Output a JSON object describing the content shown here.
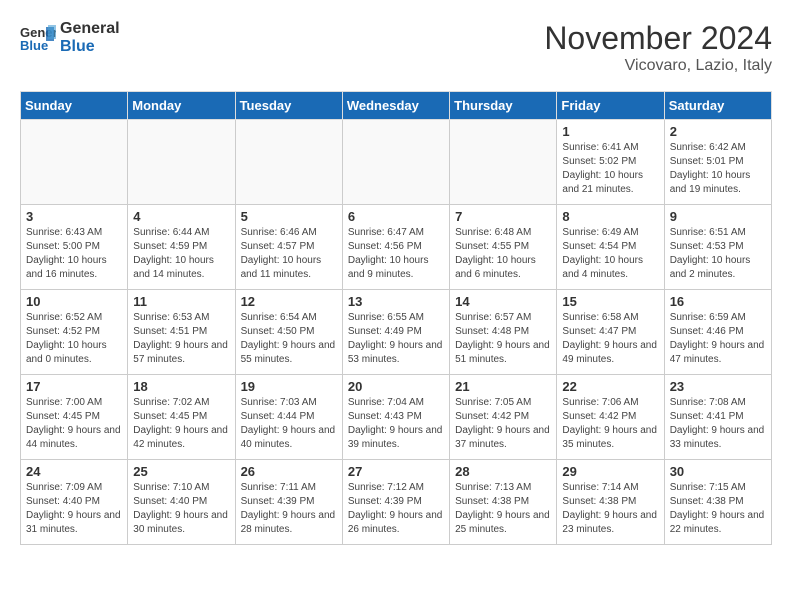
{
  "logo": {
    "line1": "General",
    "line2": "Blue"
  },
  "title": "November 2024",
  "subtitle": "Vicovaro, Lazio, Italy",
  "headers": [
    "Sunday",
    "Monday",
    "Tuesday",
    "Wednesday",
    "Thursday",
    "Friday",
    "Saturday"
  ],
  "weeks": [
    [
      {
        "day": "",
        "info": ""
      },
      {
        "day": "",
        "info": ""
      },
      {
        "day": "",
        "info": ""
      },
      {
        "day": "",
        "info": ""
      },
      {
        "day": "",
        "info": ""
      },
      {
        "day": "1",
        "info": "Sunrise: 6:41 AM\nSunset: 5:02 PM\nDaylight: 10 hours and 21 minutes."
      },
      {
        "day": "2",
        "info": "Sunrise: 6:42 AM\nSunset: 5:01 PM\nDaylight: 10 hours and 19 minutes."
      }
    ],
    [
      {
        "day": "3",
        "info": "Sunrise: 6:43 AM\nSunset: 5:00 PM\nDaylight: 10 hours and 16 minutes."
      },
      {
        "day": "4",
        "info": "Sunrise: 6:44 AM\nSunset: 4:59 PM\nDaylight: 10 hours and 14 minutes."
      },
      {
        "day": "5",
        "info": "Sunrise: 6:46 AM\nSunset: 4:57 PM\nDaylight: 10 hours and 11 minutes."
      },
      {
        "day": "6",
        "info": "Sunrise: 6:47 AM\nSunset: 4:56 PM\nDaylight: 10 hours and 9 minutes."
      },
      {
        "day": "7",
        "info": "Sunrise: 6:48 AM\nSunset: 4:55 PM\nDaylight: 10 hours and 6 minutes."
      },
      {
        "day": "8",
        "info": "Sunrise: 6:49 AM\nSunset: 4:54 PM\nDaylight: 10 hours and 4 minutes."
      },
      {
        "day": "9",
        "info": "Sunrise: 6:51 AM\nSunset: 4:53 PM\nDaylight: 10 hours and 2 minutes."
      }
    ],
    [
      {
        "day": "10",
        "info": "Sunrise: 6:52 AM\nSunset: 4:52 PM\nDaylight: 10 hours and 0 minutes."
      },
      {
        "day": "11",
        "info": "Sunrise: 6:53 AM\nSunset: 4:51 PM\nDaylight: 9 hours and 57 minutes."
      },
      {
        "day": "12",
        "info": "Sunrise: 6:54 AM\nSunset: 4:50 PM\nDaylight: 9 hours and 55 minutes."
      },
      {
        "day": "13",
        "info": "Sunrise: 6:55 AM\nSunset: 4:49 PM\nDaylight: 9 hours and 53 minutes."
      },
      {
        "day": "14",
        "info": "Sunrise: 6:57 AM\nSunset: 4:48 PM\nDaylight: 9 hours and 51 minutes."
      },
      {
        "day": "15",
        "info": "Sunrise: 6:58 AM\nSunset: 4:47 PM\nDaylight: 9 hours and 49 minutes."
      },
      {
        "day": "16",
        "info": "Sunrise: 6:59 AM\nSunset: 4:46 PM\nDaylight: 9 hours and 47 minutes."
      }
    ],
    [
      {
        "day": "17",
        "info": "Sunrise: 7:00 AM\nSunset: 4:45 PM\nDaylight: 9 hours and 44 minutes."
      },
      {
        "day": "18",
        "info": "Sunrise: 7:02 AM\nSunset: 4:45 PM\nDaylight: 9 hours and 42 minutes."
      },
      {
        "day": "19",
        "info": "Sunrise: 7:03 AM\nSunset: 4:44 PM\nDaylight: 9 hours and 40 minutes."
      },
      {
        "day": "20",
        "info": "Sunrise: 7:04 AM\nSunset: 4:43 PM\nDaylight: 9 hours and 39 minutes."
      },
      {
        "day": "21",
        "info": "Sunrise: 7:05 AM\nSunset: 4:42 PM\nDaylight: 9 hours and 37 minutes."
      },
      {
        "day": "22",
        "info": "Sunrise: 7:06 AM\nSunset: 4:42 PM\nDaylight: 9 hours and 35 minutes."
      },
      {
        "day": "23",
        "info": "Sunrise: 7:08 AM\nSunset: 4:41 PM\nDaylight: 9 hours and 33 minutes."
      }
    ],
    [
      {
        "day": "24",
        "info": "Sunrise: 7:09 AM\nSunset: 4:40 PM\nDaylight: 9 hours and 31 minutes."
      },
      {
        "day": "25",
        "info": "Sunrise: 7:10 AM\nSunset: 4:40 PM\nDaylight: 9 hours and 30 minutes."
      },
      {
        "day": "26",
        "info": "Sunrise: 7:11 AM\nSunset: 4:39 PM\nDaylight: 9 hours and 28 minutes."
      },
      {
        "day": "27",
        "info": "Sunrise: 7:12 AM\nSunset: 4:39 PM\nDaylight: 9 hours and 26 minutes."
      },
      {
        "day": "28",
        "info": "Sunrise: 7:13 AM\nSunset: 4:38 PM\nDaylight: 9 hours and 25 minutes."
      },
      {
        "day": "29",
        "info": "Sunrise: 7:14 AM\nSunset: 4:38 PM\nDaylight: 9 hours and 23 minutes."
      },
      {
        "day": "30",
        "info": "Sunrise: 7:15 AM\nSunset: 4:38 PM\nDaylight: 9 hours and 22 minutes."
      }
    ]
  ]
}
